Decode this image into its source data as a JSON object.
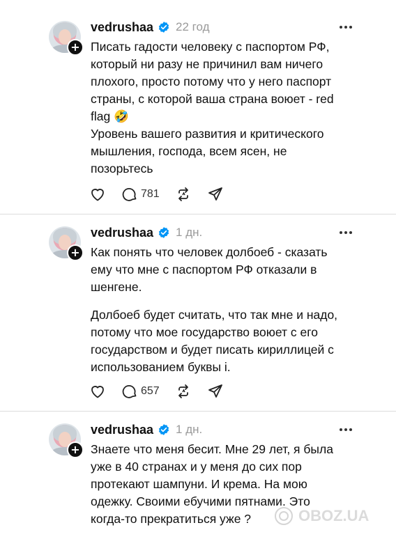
{
  "posts": [
    {
      "username": "vedrushaa",
      "time": "22 год",
      "paragraphs": [
        "Писать гадости человеку с паспортом РФ,\nкоторый ни разу не причинил вам ничего\nплохого, просто потому что у него паспорт\nстраны, с которой ваша страна воюет - red\nflag 🤣",
        "Уровень вашего развития и критического\nмышления, господа, всем ясен, не\nпозорьтесь"
      ],
      "reply_count": "781"
    },
    {
      "username": "vedrushaa",
      "time": "1 дн.",
      "paragraphs": [
        "Как понять что человек долбоеб - сказать\nему что мне с паспортом РФ отказали в\nшенгене.",
        "Долбоеб будет считать, что так мне и надо,\nпотому что мое государство воюет с его\nгосударством и будет писать кириллицей с\nиспользованием буквы і."
      ],
      "reply_count": "657"
    },
    {
      "username": "vedrushaa",
      "time": "1 дн.",
      "paragraphs": [
        "Знаете что меня бесит. Мне 29 лет, я была\nуже в 40 странах и у меня до сих пор\nпротекают шампуни. И крема. На мою\nодежку. Своими ебучими пятнами. Это\nкогда-то прекратиться уже ?"
      ]
    }
  ],
  "watermark": "OBOZ.UA",
  "colors": {
    "verified": "#0095f6",
    "muted": "#9a9a9a",
    "text": "#101010"
  },
  "icons": [
    "heart-icon",
    "comment-icon",
    "repost-icon",
    "share-icon",
    "more-icon",
    "verified-icon",
    "follow-plus-icon"
  ]
}
